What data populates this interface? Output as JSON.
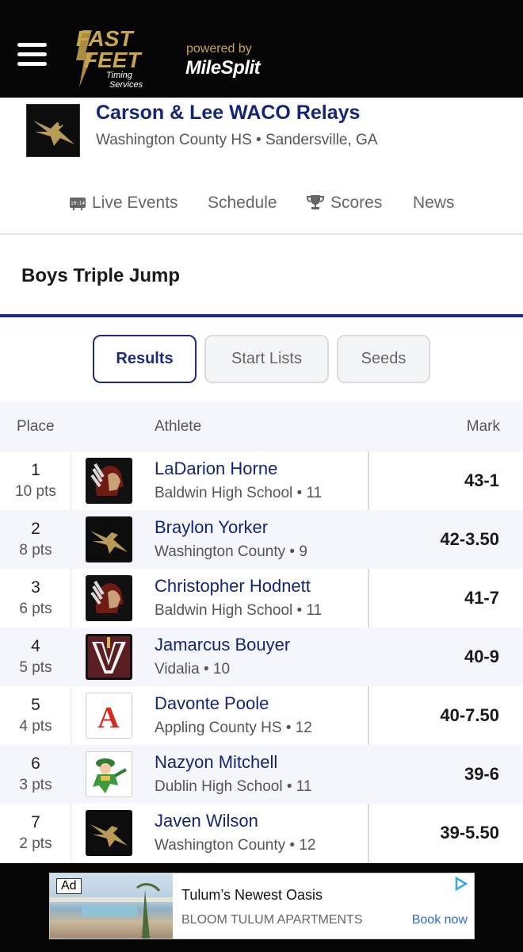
{
  "header": {
    "logo_text": "FAST FEET Timing Services",
    "powered_by": "powered by",
    "partner": "MileSplit"
  },
  "meet": {
    "title": "Carson & Lee WACO Relays",
    "subtitle": "Washington County HS • Sandersville, GA"
  },
  "nav": {
    "live_events": "Live Events",
    "live_icon_text": "10:14",
    "schedule": "Schedule",
    "scores": "Scores",
    "news": "News"
  },
  "event": {
    "title": "Boys Triple Jump"
  },
  "tabs": {
    "results": "Results",
    "start_lists": "Start Lists",
    "seeds": "Seeds"
  },
  "table": {
    "headers": {
      "place": "Place",
      "athlete": "Athlete",
      "mark": "Mark"
    },
    "rows": [
      {
        "place": "1",
        "pts": "10 pts",
        "name": "LaDarion Horne",
        "school": "Baldwin High School • 11",
        "mark": "43-1",
        "logo": "warrior-head"
      },
      {
        "place": "2",
        "pts": "8 pts",
        "name": "Braylon Yorker",
        "school": "Washington County • 9",
        "mark": "42-3.50",
        "logo": "golden-hawk"
      },
      {
        "place": "3",
        "pts": "6 pts",
        "name": "Christopher Hodnett",
        "school": "Baldwin High School • 11",
        "mark": "41-7",
        "logo": "warrior-head"
      },
      {
        "place": "4",
        "pts": "5 pts",
        "name": "Jamarcus Bouyer",
        "school": "Vidalia • 10",
        "mark": "40-9",
        "logo": "vidalia-v"
      },
      {
        "place": "5",
        "pts": "4 pts",
        "name": "Davonte Poole",
        "school": "Appling County HS • 12",
        "mark": "40-7.50",
        "logo": "appling-a"
      },
      {
        "place": "6",
        "pts": "3 pts",
        "name": "Nazyon Mitchell",
        "school": "Dublin High School • 11",
        "mark": "39-6",
        "logo": "fighting-irish"
      },
      {
        "place": "7",
        "pts": "2 pts",
        "name": "Javen Wilson",
        "school": "Washington County • 12",
        "mark": "39-5.50",
        "logo": "golden-hawk"
      }
    ]
  },
  "ad": {
    "badge": "Ad",
    "title": "Tulum’s Newest Oasis",
    "brand": "BLOOM TULUM APARTMENTS",
    "cta": "Book now"
  },
  "colors": {
    "navy": "#142673",
    "gold": "#c8a64e",
    "topbar": "#050505"
  }
}
